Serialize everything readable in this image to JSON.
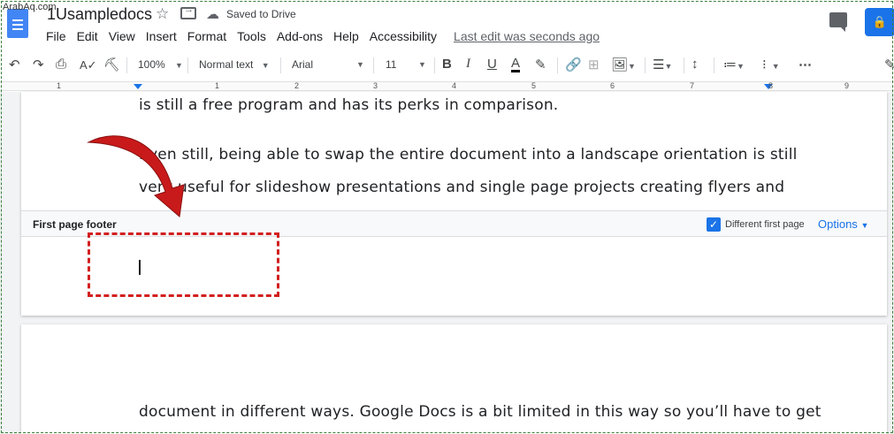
{
  "watermark": "ArabAq.com",
  "title_bar": {
    "doc_title": "1Usampledocs",
    "saved_status": "Saved to Drive",
    "icons": [
      "docs-logo-icon",
      "star-icon",
      "move-to-folder-icon",
      "cloud-icon",
      "comment-icon",
      "lock-icon"
    ],
    "share_icon": "🔒"
  },
  "menu": {
    "items": [
      "File",
      "Edit",
      "View",
      "Insert",
      "Format",
      "Tools",
      "Add-ons",
      "Help",
      "Accessibility"
    ],
    "last_edit": "Last edit was seconds ago"
  },
  "toolbar": {
    "zoom": "100%",
    "style": "Normal text",
    "font": "Arial",
    "font_size": "11"
  },
  "ruler": {
    "numbers": [
      "1",
      "1",
      "2",
      "3",
      "4",
      "5",
      "6",
      "7",
      "8",
      "9"
    ]
  },
  "document": {
    "line1": "is still a free program and has its perks in comparison.",
    "line2": "Even still, being able to swap the entire document into a landscape orientation is still",
    "line3": "very useful for slideshow presentations and single page projects creating flyers and",
    "line4": "document in different ways. Google Docs is a bit limited in this way so you’ll have to get"
  },
  "footer": {
    "label": "First page footer",
    "checkbox_checked": true,
    "checkbox_label": "Different first page",
    "options_label": "Options"
  },
  "colors": {
    "accent": "#1a73e8",
    "annotation": "#d21f1f"
  }
}
